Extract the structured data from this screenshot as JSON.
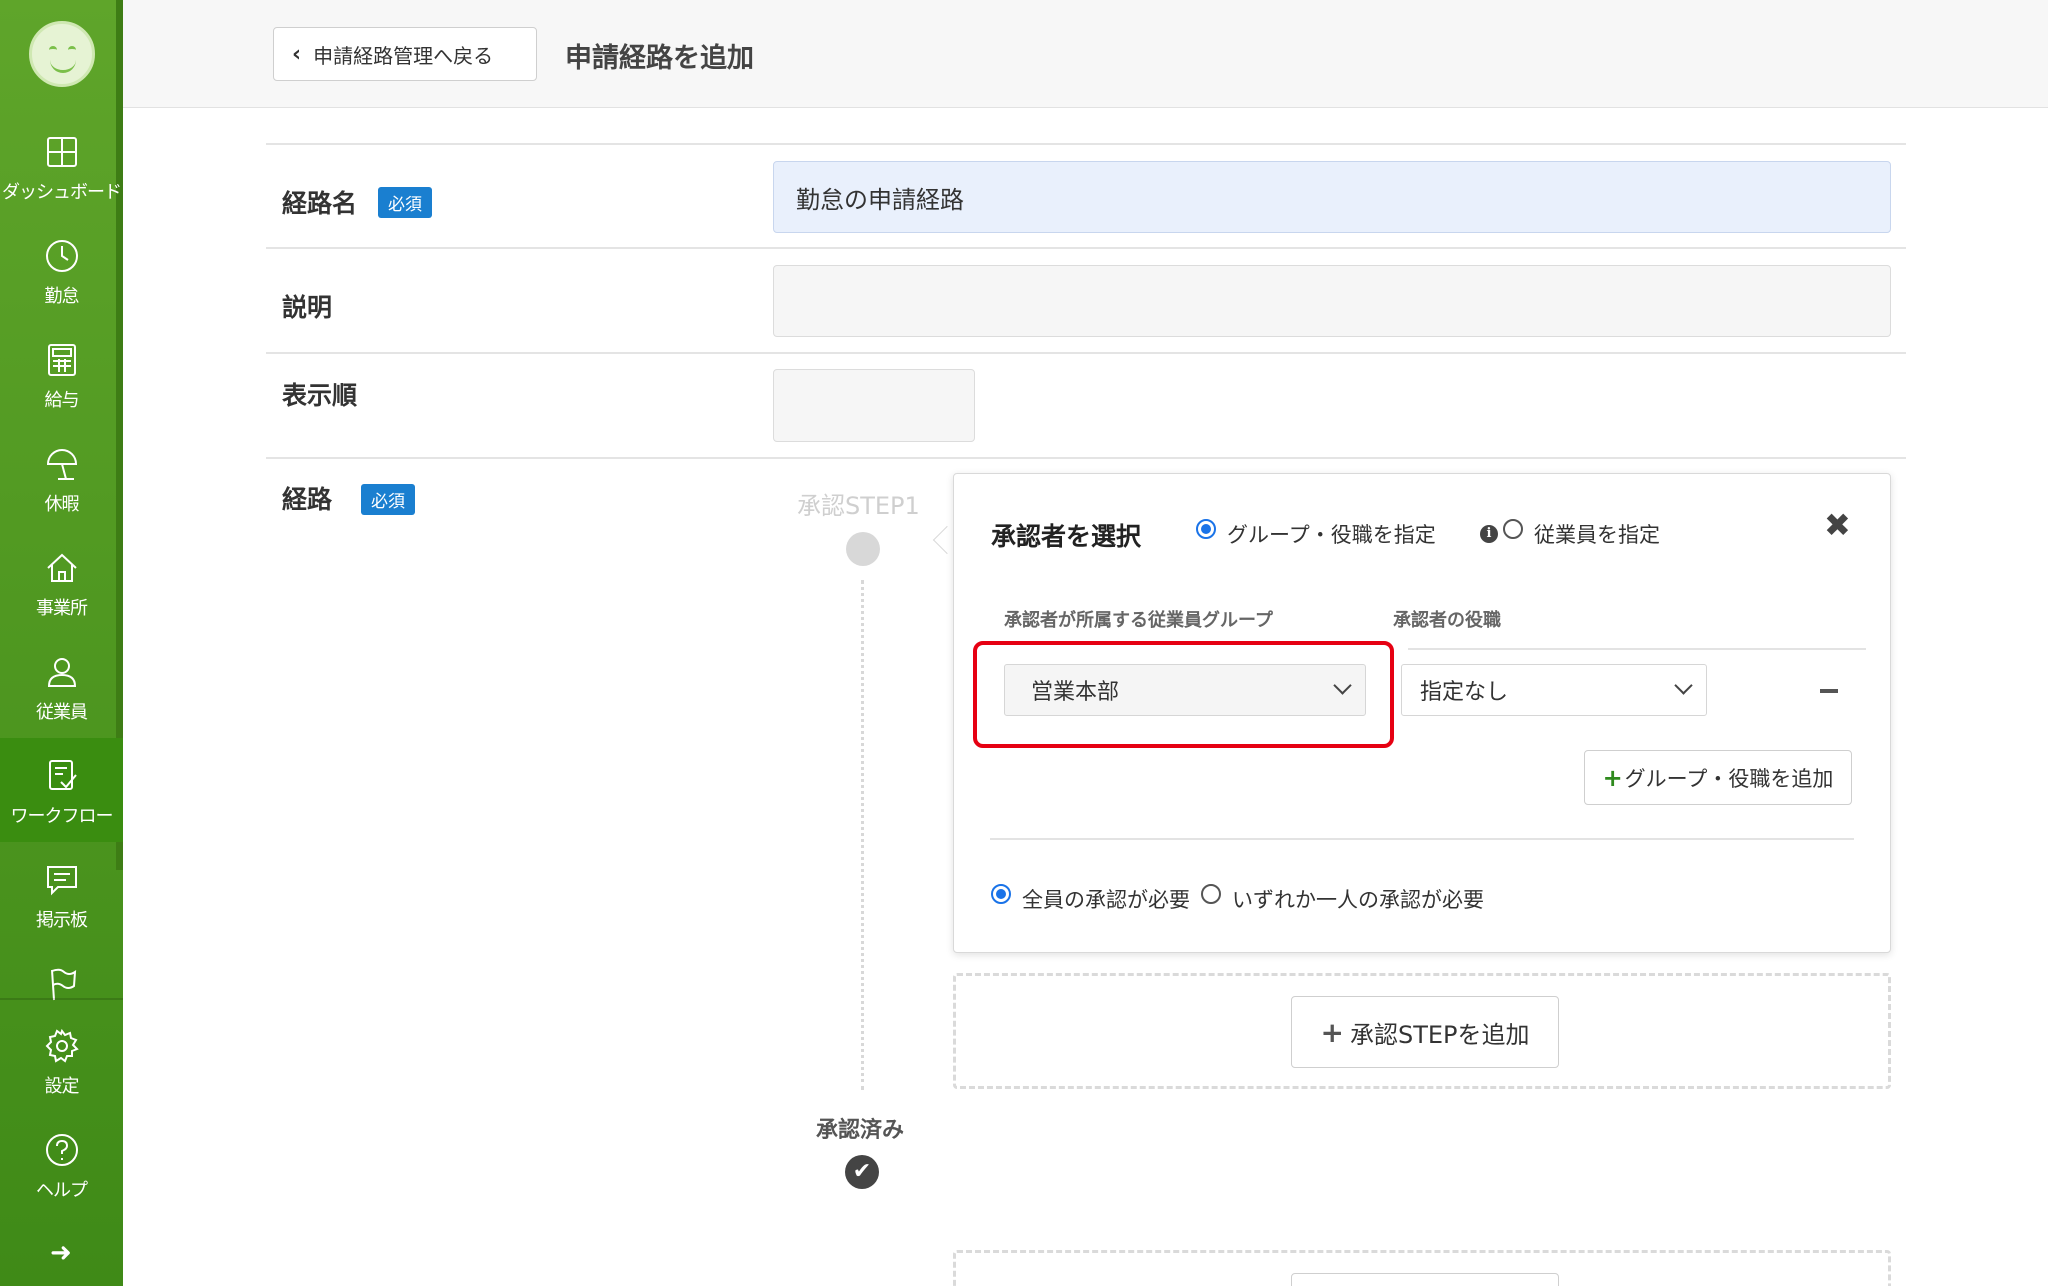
{
  "sidebar": {
    "items": [
      {
        "label": "ダッシュボード",
        "icon": "dashboard-icon"
      },
      {
        "label": "勤怠",
        "icon": "clock-icon"
      },
      {
        "label": "給与",
        "icon": "calculator-icon"
      },
      {
        "label": "休暇",
        "icon": "umbrella-icon"
      },
      {
        "label": "事業所",
        "icon": "home-icon"
      },
      {
        "label": "従業員",
        "icon": "person-icon"
      },
      {
        "label": "ワークフロー",
        "icon": "workflow-icon"
      },
      {
        "label": "掲示板",
        "icon": "message-icon"
      },
      {
        "label": "",
        "icon": "flag-icon"
      },
      {
        "label": "設定",
        "icon": "gear-icon"
      },
      {
        "label": "ヘルプ",
        "icon": "help-icon"
      }
    ],
    "active_index": 6,
    "brand_color": "#4f9a1f"
  },
  "header": {
    "back_label": "申請経路管理へ戻る",
    "title": "申請経路を追加"
  },
  "form": {
    "name_label": "経路名",
    "required_badge": "必須",
    "name_value": "勤怠の申請経路",
    "description_label": "説明",
    "description_value": "",
    "order_label": "表示順",
    "order_value": "",
    "route_label": "経路"
  },
  "route": {
    "step_label": "承認STEP1",
    "done_label": "承認済み",
    "add_step_label": "承認STEPを追加"
  },
  "approver_panel": {
    "title": "承認者を選択",
    "mode_group_label": "グループ・役職を指定",
    "mode_employee_label": "従業員を指定",
    "mode_selected": "group",
    "col_group_header": "承認者が所属する従業員グループ",
    "col_role_header": "承認者の役職",
    "group_value": "営業本部",
    "role_value": "指定なし",
    "add_group_label": "グループ・役職を追加",
    "approve_all_label": "全員の承認が必要",
    "approve_any_label": "いずれか一人の承認が必要",
    "approve_selected": "all",
    "highlight_color": "#e60012"
  }
}
